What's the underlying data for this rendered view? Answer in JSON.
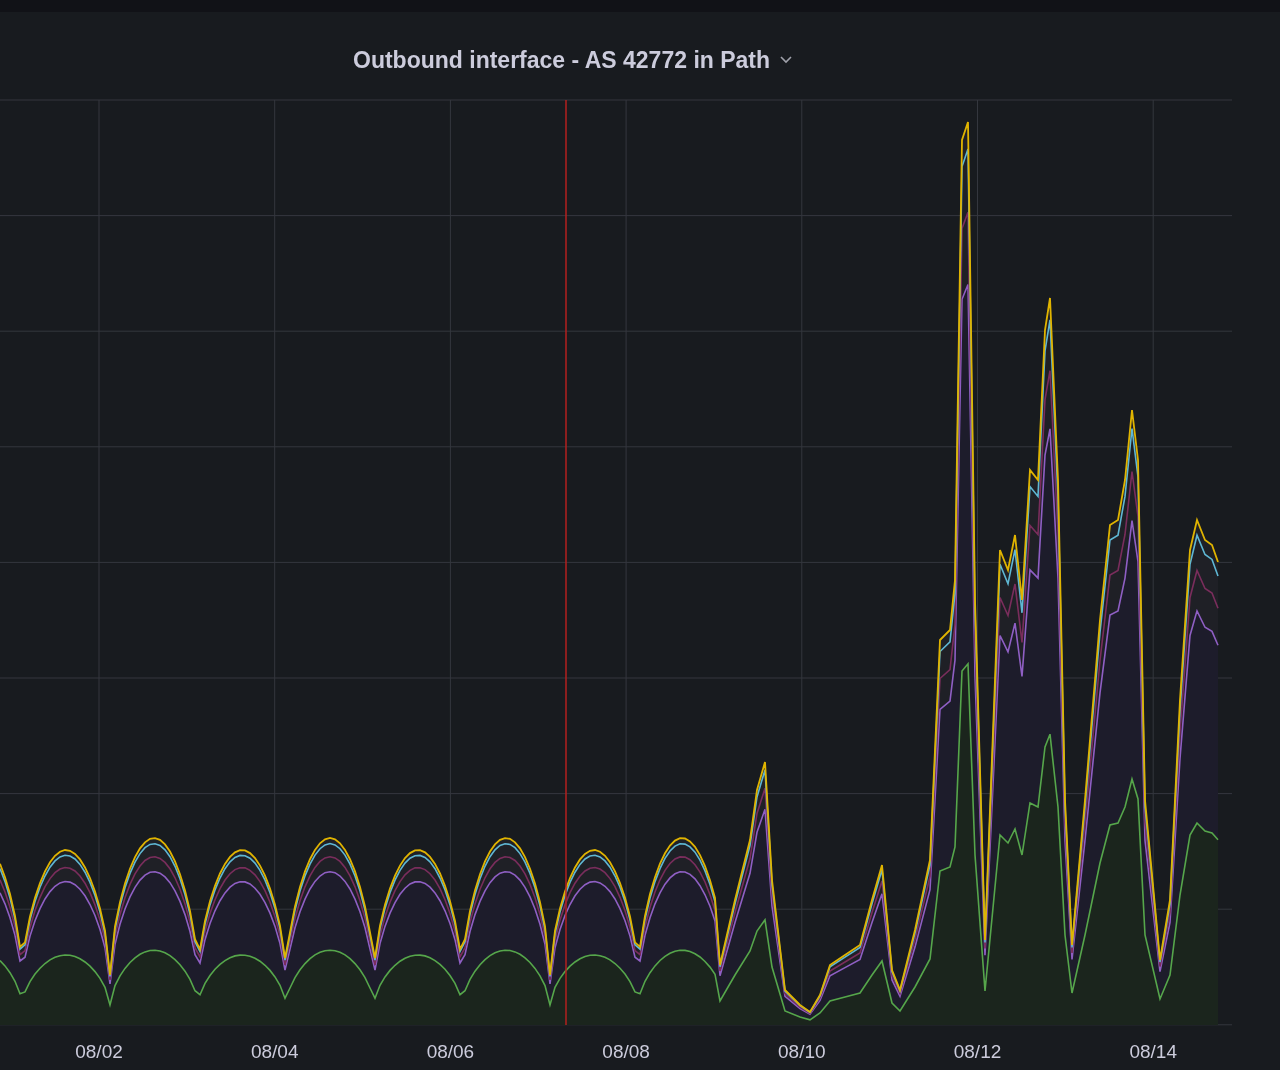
{
  "panel": {
    "title": "Outbound interface - AS 42772 in Path"
  },
  "x_axis": {
    "labels": [
      "08/02",
      "08/04",
      "08/06",
      "08/08",
      "08/10",
      "08/12",
      "08/14"
    ]
  }
}
